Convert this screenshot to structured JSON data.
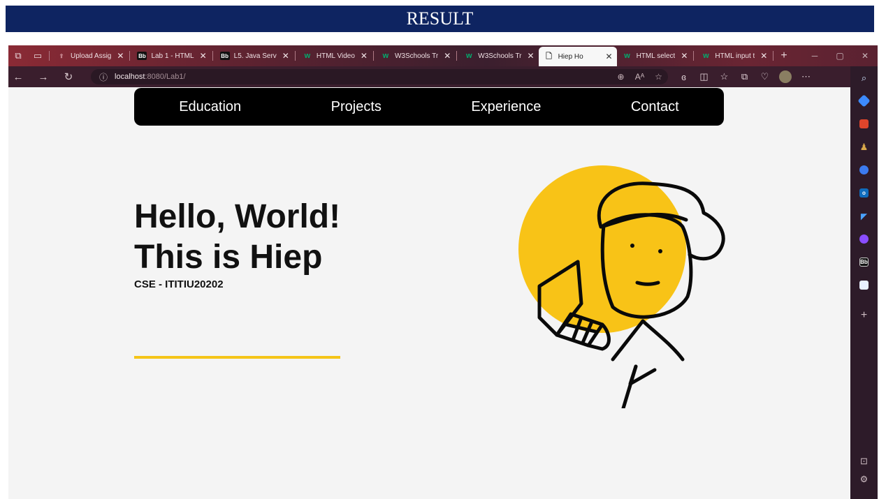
{
  "banner": {
    "title": "RESULT"
  },
  "browser": {
    "tabs": [
      {
        "title": "Upload Assig",
        "favicon": "upload-favicon"
      },
      {
        "title": "Lab 1 - HTML",
        "favicon": "blackboard-favicon"
      },
      {
        "title": "L5. Java Serv",
        "favicon": "blackboard-favicon"
      },
      {
        "title": "HTML Video",
        "favicon": "w3schools-favicon"
      },
      {
        "title": "W3Schools Tr",
        "favicon": "w3schools-favicon"
      },
      {
        "title": "W3Schools Tr",
        "favicon": "w3schools-favicon"
      },
      {
        "title": "Hiep Ho",
        "favicon": "page-favicon",
        "active": true
      },
      {
        "title": "HTML select",
        "favicon": "w3schools-favicon"
      },
      {
        "title": "HTML input t",
        "favicon": "w3schools-favicon"
      }
    ],
    "address": {
      "host": "localhost",
      "path": ":8080/Lab1/"
    },
    "sidebar_icons": [
      "search-icon",
      "tag-icon",
      "briefcase-icon",
      "chess-icon",
      "bubble-icon",
      "outlook-icon",
      "send-icon",
      "messenger-icon",
      "blackboard-icon",
      "app-icon"
    ]
  },
  "site": {
    "nav": {
      "education": "Education",
      "projects": "Projects",
      "experience": "Experience",
      "contact": "Contact"
    },
    "hero": {
      "line1": "Hello, World!",
      "line2": "This is Hiep",
      "subtitle": "CSE - ITITIU20202"
    },
    "accent_color": "#f5c518"
  }
}
